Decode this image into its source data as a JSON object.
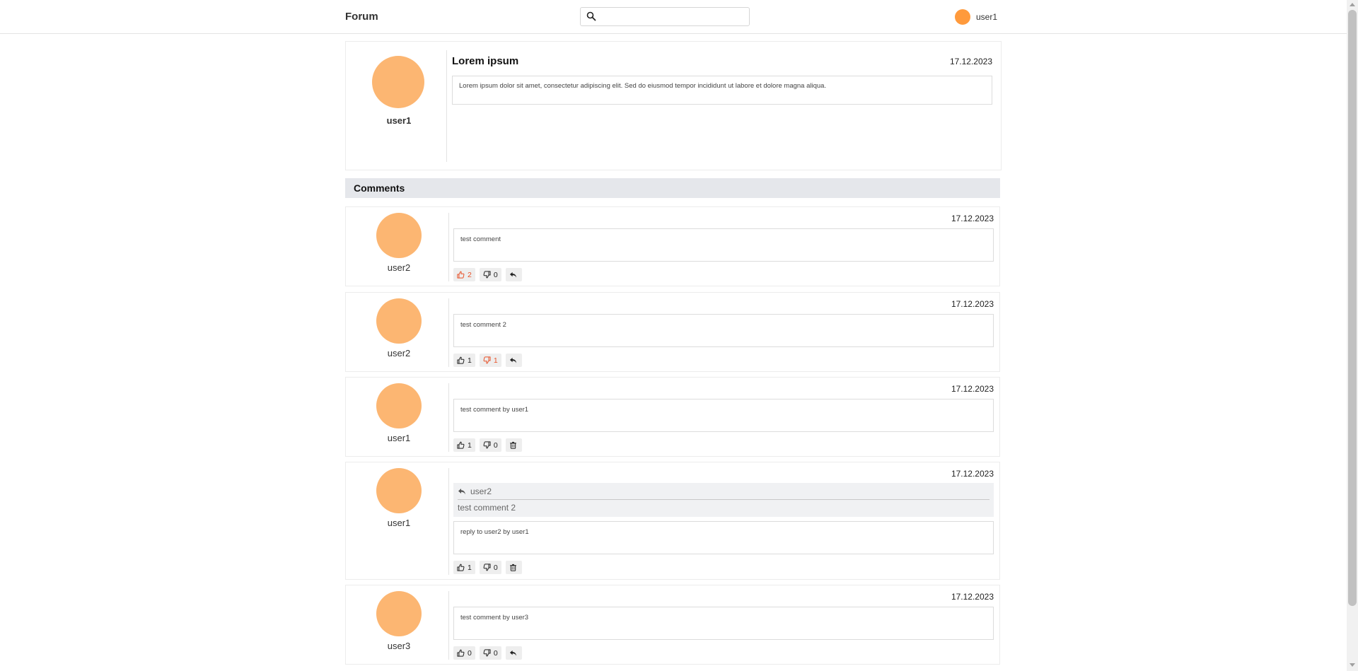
{
  "header": {
    "brand": "Forum",
    "search_placeholder": "",
    "current_user": "user1"
  },
  "post": {
    "author": "user1",
    "title": "Lorem ipsum",
    "date": "17.12.2023",
    "body": "Lorem ipsum dolor sit amet, consectetur adipiscing elit. Sed do eiusmod tempor incididunt ut labore et dolore magna aliqua."
  },
  "comments_header": "Comments",
  "comments": [
    {
      "author": "user2",
      "date": "17.12.2023",
      "text": "test comment",
      "likes": "2",
      "dislikes": "0",
      "liked": true,
      "disliked": false,
      "third_action": "reply"
    },
    {
      "author": "user2",
      "date": "17.12.2023",
      "text": "test comment 2",
      "likes": "1",
      "dislikes": "1",
      "liked": false,
      "disliked": true,
      "third_action": "reply"
    },
    {
      "author": "user1",
      "date": "17.12.2023",
      "text": "test comment by user1",
      "likes": "1",
      "dislikes": "0",
      "liked": false,
      "disliked": false,
      "third_action": "delete"
    },
    {
      "author": "user1",
      "date": "17.12.2023",
      "text": "reply to user2 by user1",
      "likes": "1",
      "dislikes": "0",
      "liked": false,
      "disliked": false,
      "third_action": "delete",
      "reply_to": {
        "author": "user2",
        "text": "test comment 2"
      }
    },
    {
      "author": "user3",
      "date": "17.12.2023",
      "text": "test comment by user3",
      "likes": "0",
      "dislikes": "0",
      "liked": false,
      "disliked": false,
      "third_action": "reply"
    }
  ],
  "colors": {
    "accent_liked": "#e8532a",
    "avatar": "#fcb672",
    "user_dot": "#ff9a3c"
  }
}
